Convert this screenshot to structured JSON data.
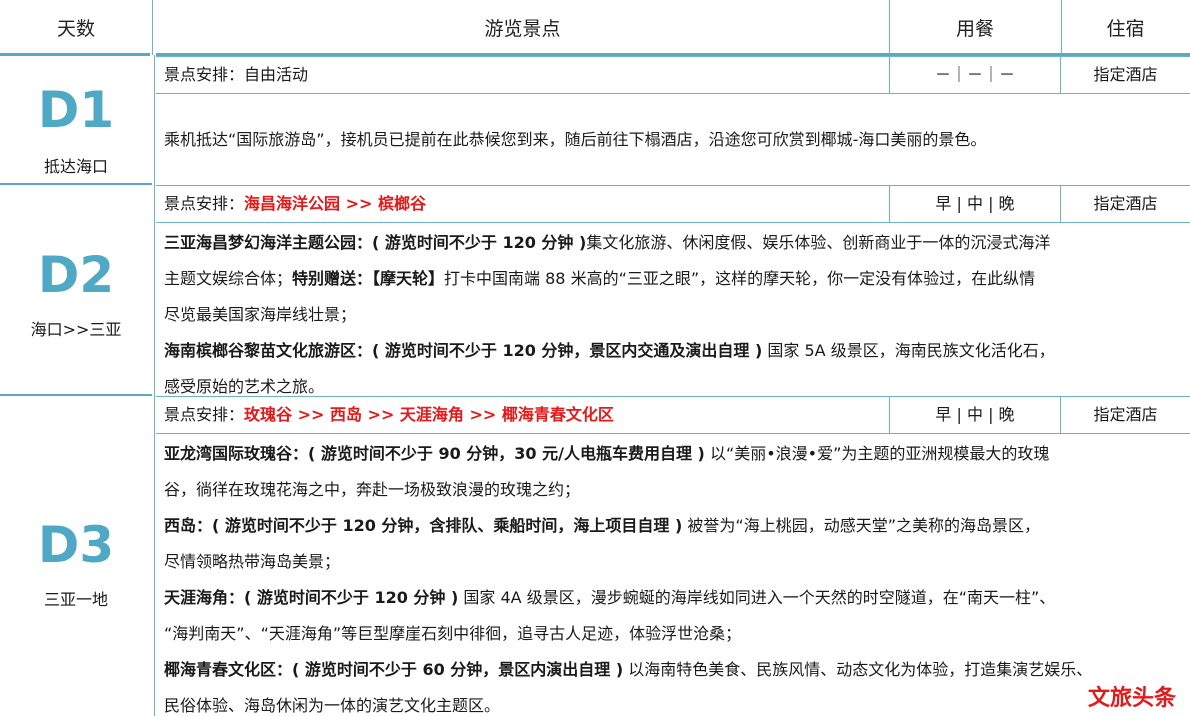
{
  "header": {
    "day": "天数",
    "sights": "游览景点",
    "meal": "用餐",
    "hotel": "住宿"
  },
  "days": [
    {
      "code": "D1",
      "route": "抵达海口",
      "schedule_label": "景点安排：",
      "schedule_value": "自由活动",
      "meal": "－｜－｜－",
      "hotel": "指定酒店",
      "desc": "乘机抵达“国际旅游岛”，接机员已提前在此恭候您到来，随后前往下榻酒店，沿途您可欣赏到椰城-海口美丽的景色。"
    },
    {
      "code": "D2",
      "route": "海口>>三亚",
      "schedule_label": "景点安排：",
      "schedule_value": "海昌海洋公园  >>  槟榔谷",
      "meal": "早 | 中 | 晚",
      "hotel": "指定酒店",
      "p1_bold": "三亚海昌梦幻海洋主题公园：( 游览时间不少于 120 分钟 )",
      "p1_text": "集文化旅游、休闲度假、娱乐体验、创新商业于一体的沉浸式海洋",
      "p1_line2": "主题文娱综合体；",
      "p1_bold2": "特别赠送：【摩天轮】",
      "p1_text2": "打卡中国南端 88 米高的“三亚之眼”，这样的摩天轮，你一定没有体验过，在此纵情",
      "p1_line3": "尽览最美国家海岸线壮景；",
      "p2_bold": "海南槟榔谷黎苗文化旅游区：( 游览时间不少于 120 分钟，景区内交通及演出自理 )",
      "p2_text": " 国家 5A 级景区，海南民族文化活化石，",
      "p2_line2": "感受原始的艺术之旅。"
    },
    {
      "code": "D3",
      "route": "三亚一地",
      "schedule_label": "景点安排：",
      "schedule_value": "玫瑰谷  >>  西岛  >>  天涯海角  >>  椰海青春文化区",
      "meal": "早 | 中 | 晚",
      "hotel": "指定酒店",
      "p1_bold": "亚龙湾国际玫瑰谷：( 游览时间不少于 90 分钟，30 元/人电瓶车费用自理 )",
      "p1_text": " 以“美丽•浪漫•爱”为主题的亚洲规模最大的玫瑰",
      "p1_line2": "谷，徜徉在玫瑰花海之中，奔赴一场极致浪漫的玫瑰之约；",
      "p2_bold": "西岛：( 游览时间不少于 120 分钟，含排队、乘船时间，海上项目自理 )",
      "p2_text": " 被誉为“海上桃园，动感天堂”之美称的海岛景区，",
      "p2_line2": "尽情领略热带海岛美景；",
      "p3_bold": "天涯海角：( 游览时间不少于 120 分钟 )",
      "p3_text": " 国家 4A 级景区，漫步蜿蜒的海岸线如同进入一个天然的时空隧道，在“南天一柱”、",
      "p3_line2": "“海判南天”、“天涯海角”等巨型摩崖石刻中徘徊，追寻古人足迹，体验浮世沧桑；",
      "p4_bold": "椰海青春文化区：( 游览时间不少于 60 分钟，景区内演出自理 )",
      "p4_text": " 以海南特色美食、民族风情、动态文化为体验，打造集演艺娱乐、",
      "p4_line2": "民俗体验、海岛休闲为一体的演艺文化主题区。"
    }
  ],
  "watermark": "文旅头条",
  "colors": {
    "accent": "#4fa9c4",
    "line": "#5aa8c4",
    "highlight": "#e3191a"
  }
}
